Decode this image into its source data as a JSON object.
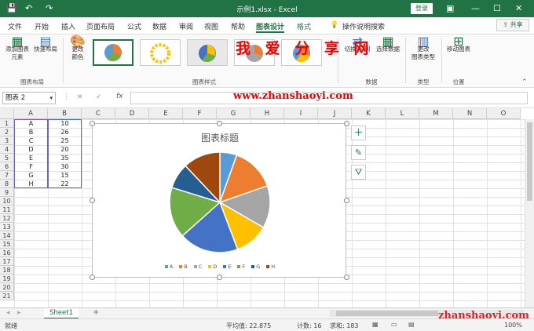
{
  "window": {
    "title": "示例1.xlsx  -  Excel",
    "login": "登录",
    "minimize": "—",
    "restore": "☐",
    "close": "✕",
    "save_icon": "save-icon",
    "undo_icon": "undo-icon",
    "redo_icon": "redo-icon"
  },
  "tabs": [
    {
      "label": "文件"
    },
    {
      "label": "开始"
    },
    {
      "label": "插入"
    },
    {
      "label": "页面布局"
    },
    {
      "label": "公式"
    },
    {
      "label": "数据"
    },
    {
      "label": "审阅"
    },
    {
      "label": "视图"
    },
    {
      "label": "帮助"
    },
    {
      "label": "图表设计"
    },
    {
      "label": "格式"
    },
    {
      "label": "操作说明搜索"
    }
  ],
  "share": "共享",
  "ribbon": {
    "add_element": "添加图表\n元素",
    "quick_layout": "快速布局",
    "change_color": "更改\n颜色",
    "group_layout": "图表布局",
    "group_style": "图表样式",
    "switch_row_col": "切换行/列",
    "select_data": "选择数据",
    "group_data": "数据",
    "change_type": "更改\n图表类型",
    "group_type": "类型",
    "move_chart": "移动图表",
    "group_location": "位置"
  },
  "watermark": {
    "title": "我 爱 分 享 网",
    "url": "www.zhanshaoyi.com",
    "bottom": "zhanshaoyi.com"
  },
  "formula_bar": {
    "name_box": "图表 2",
    "cancel": "✕",
    "enter": "✓",
    "fx": "fx",
    "formula": ""
  },
  "columns": [
    "A",
    "B",
    "C",
    "D",
    "E",
    "F",
    "G",
    "H",
    "I",
    "J",
    "K",
    "L",
    "M",
    "N",
    "O"
  ],
  "rows": [
    "1",
    "2",
    "3",
    "4",
    "5",
    "6",
    "7",
    "8",
    "9",
    "10",
    "11",
    "12",
    "13",
    "14",
    "15",
    "16",
    "17",
    "18",
    "19",
    "20",
    "21"
  ],
  "table": [
    {
      "a": "A",
      "b": "10"
    },
    {
      "a": "B",
      "b": "26"
    },
    {
      "a": "C",
      "b": "25"
    },
    {
      "a": "D",
      "b": "20"
    },
    {
      "a": "E",
      "b": "35"
    },
    {
      "a": "F",
      "b": "30"
    },
    {
      "a": "G",
      "b": "15"
    },
    {
      "a": "H",
      "b": "22"
    }
  ],
  "chart_data": {
    "type": "pie",
    "title": "图表标题",
    "categories": [
      "A",
      "B",
      "C",
      "D",
      "E",
      "F",
      "G",
      "H"
    ],
    "values": [
      10,
      26,
      25,
      20,
      35,
      30,
      15,
      22
    ],
    "colors": [
      "#5B9BD5",
      "#ED7D31",
      "#A5A5A5",
      "#FFC000",
      "#4472C4",
      "#70AD47",
      "#255E91",
      "#9E480E"
    ],
    "legend": "bottom"
  },
  "sheet": {
    "tab": "Sheet1",
    "add": "+"
  },
  "status": {
    "ready": "就绪",
    "average": "平均值: 22.875",
    "count": "计数: 16",
    "sum": "求和: 183",
    "zoom": "100%"
  }
}
